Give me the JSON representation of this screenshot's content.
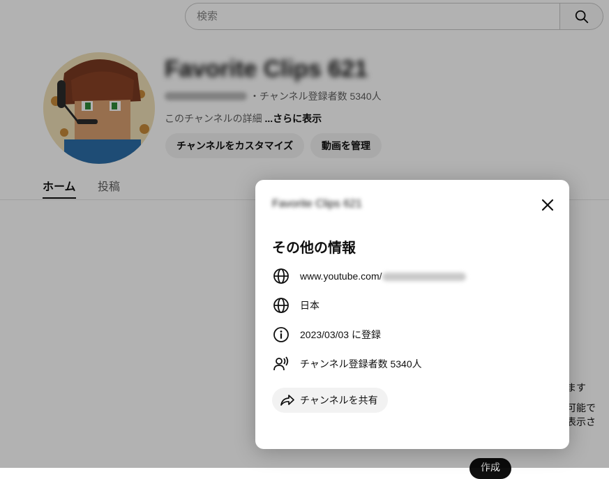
{
  "search": {
    "placeholder": "検索",
    "icon": "search-icon"
  },
  "channel": {
    "name": "Favorite Clips 621",
    "subscribers_text": "・チャンネル登録者数 5340人",
    "description_prefix": "このチャンネルの詳細 ",
    "description_more": "...さらに表示",
    "customize_button": "チャンネルをカスタマイズ",
    "manage_videos_button": "動画を管理"
  },
  "tabs": [
    {
      "label": "ホーム",
      "active": true
    },
    {
      "label": "投稿",
      "active": false
    }
  ],
  "background_text": {
    "line1": "ます",
    "line2": "可能で",
    "line3": "表示さ",
    "create_button": "作成"
  },
  "dialog": {
    "title": "Favorite Clips 621",
    "close_icon": "close-icon",
    "heading": "その他の情報",
    "rows": [
      {
        "icon": "globe-icon",
        "text": "www.youtube.com/"
      },
      {
        "icon": "globe-icon",
        "text": "日本"
      },
      {
        "icon": "info-icon",
        "text": "2023/03/03 に登録"
      },
      {
        "icon": "subscribers-icon",
        "text": "チャンネル登録者数 5340人"
      }
    ],
    "share_button": {
      "icon": "share-icon",
      "label": "チャンネルを共有"
    }
  },
  "colors": {
    "scrim": "#0000004d",
    "pill_bg": "#f2f2f2",
    "text_primary": "#0f0f0f",
    "text_secondary": "#606060"
  }
}
